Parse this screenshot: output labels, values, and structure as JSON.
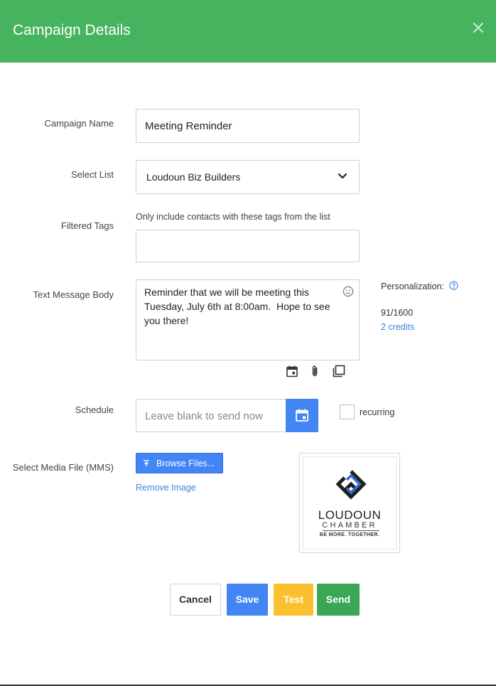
{
  "header": {
    "title": "Campaign Details",
    "close_icon": "close-icon"
  },
  "form": {
    "campaign_name": {
      "label": "Campaign Name",
      "value": "Meeting Reminder"
    },
    "select_list": {
      "label": "Select List",
      "value": "Loudoun Biz Builders"
    },
    "filtered_tags": {
      "label": "Filtered Tags",
      "hint": "Only include contacts with these tags from the list",
      "value": ""
    },
    "message": {
      "label": "Text Message Body",
      "value": "Reminder that we will be meeting this Tuesday, July 6th at 8:00am.  Hope to see you there!",
      "personalization_label": "Personalization:",
      "char_count": "91/1600",
      "credits": "2 credits",
      "tool_icons": [
        "calendar-icon",
        "attachment-icon",
        "copy-icon"
      ]
    },
    "schedule": {
      "label": "Schedule",
      "placeholder": "Leave blank to send now",
      "recurring_label": "recurring",
      "recurring_checked": false
    },
    "media": {
      "label": "Select Media File (MMS)",
      "browse_label": "Browse Files...",
      "remove_label": "Remove Image",
      "logo": {
        "line1": "LOUDOUN",
        "line2": "CHAMBER",
        "tagline": "BE MORE. TOGETHER."
      }
    }
  },
  "actions": {
    "cancel": "Cancel",
    "save": "Save",
    "test": "Test",
    "send": "Send"
  },
  "colors": {
    "header": "#46b35f",
    "primary": "#4285f4",
    "warning": "#fbc02d",
    "success": "#3aa757",
    "link": "#3a85d9"
  }
}
